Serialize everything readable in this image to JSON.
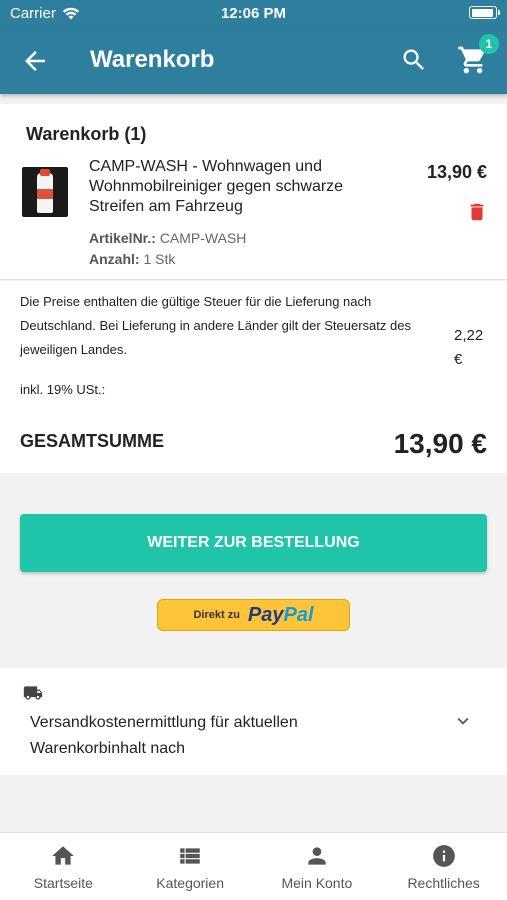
{
  "status": {
    "carrier": "Carrier",
    "time": "12:06 PM"
  },
  "appbar": {
    "title": "Warenkorb",
    "cart_count": "1"
  },
  "cart": {
    "heading": "Warenkorb (1)",
    "item": {
      "name": "CAMP-WASH - Wohnwagen und Wohnmobilreiniger gegen schwarze Streifen am Fahrzeug",
      "price": "13,90 €",
      "sku_label": "ArtikelNr.:",
      "sku": "CAMP-WASH",
      "qty_label": "Anzahl:",
      "qty": "1 Stk"
    }
  },
  "totals": {
    "tax_text": "Die Preise enthalten die gültige Steuer für die Lieferung nach Deutschland. Bei Lieferung in andere Länder gilt der Steuersatz des jeweiligen Landes.",
    "tax_value": "2,22 €",
    "incl_label": "inkl. 19% USt.:",
    "total_label": "GESAMTSUMME",
    "total_value": "13,90 €"
  },
  "checkout": {
    "button_label": "WEITER ZUR BESTELLUNG",
    "paypal_prefix": "Direkt zu",
    "paypal_pay": "Pay",
    "paypal_pal": "Pal"
  },
  "shipping": {
    "text": "Versandkostenermittlung für aktuellen Warenkorbinhalt nach"
  },
  "tabs": [
    {
      "label": "Startseite",
      "icon": "home-icon"
    },
    {
      "label": "Kategorien",
      "icon": "list-icon"
    },
    {
      "label": "Mein Konto",
      "icon": "person-icon"
    },
    {
      "label": "Rechtliches",
      "icon": "info-icon"
    }
  ],
  "colors": {
    "primary": "#2e7f9e",
    "accent": "#20c4a8",
    "delete": "#e53935",
    "paypal": "#ffc439"
  }
}
